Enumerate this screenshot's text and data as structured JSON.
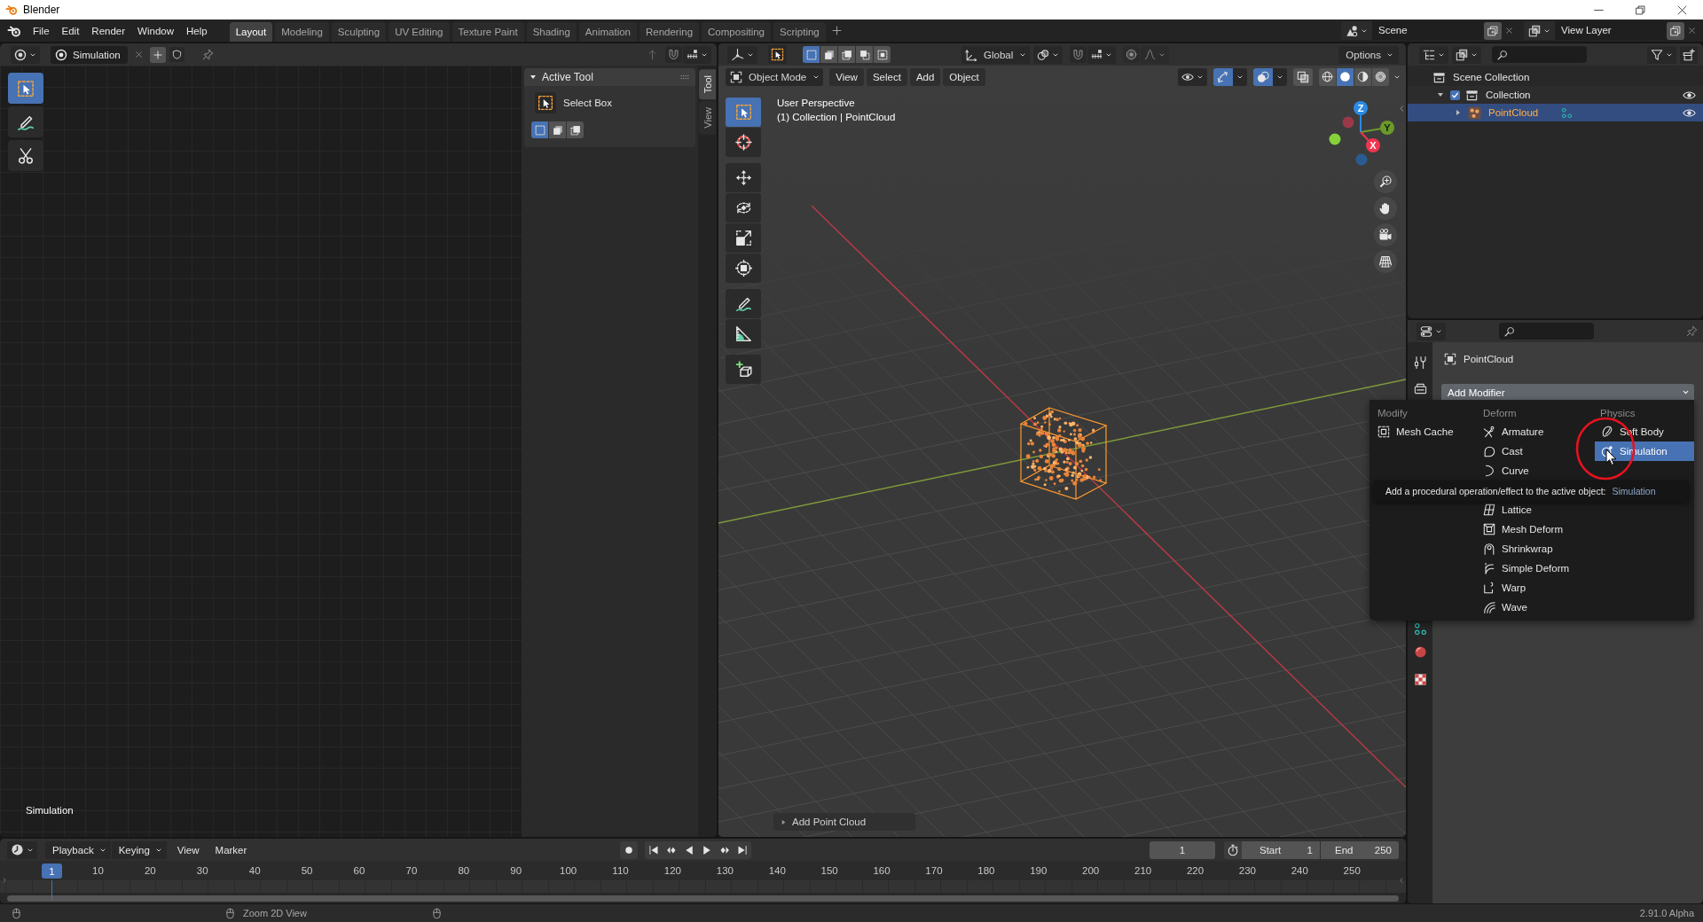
{
  "window": {
    "title": "Blender"
  },
  "menu_bar": {
    "menus": [
      "File",
      "Edit",
      "Render",
      "Window",
      "Help"
    ]
  },
  "workspaces": [
    {
      "label": "Layout",
      "selected": true
    },
    {
      "label": "Modeling",
      "selected": false
    },
    {
      "label": "Sculpting",
      "selected": false
    },
    {
      "label": "UV Editing",
      "selected": false
    },
    {
      "label": "Texture Paint",
      "selected": false
    },
    {
      "label": "Shading",
      "selected": false
    },
    {
      "label": "Animation",
      "selected": false
    },
    {
      "label": "Rendering",
      "selected": false
    },
    {
      "label": "Compositing",
      "selected": false
    },
    {
      "label": "Scripting",
      "selected": false
    }
  ],
  "scene": {
    "name": "Scene"
  },
  "view_layer": {
    "name": "View Layer"
  },
  "simulation_editor": {
    "datablock": "Simulation",
    "tools": [
      {
        "kind": "select_box",
        "selected": true
      },
      {
        "kind": "annotate",
        "selected": false
      },
      {
        "kind": "links_cut",
        "selected": false
      }
    ],
    "tree_name": "Simulation",
    "sidebar": {
      "tabs": [
        {
          "label": "Tool",
          "selected": true
        },
        {
          "label": "View",
          "selected": false
        }
      ],
      "panel": {
        "title": "Active Tool",
        "expanded": true,
        "tool": "Select Box",
        "modes": [
          {
            "selected": true
          },
          {
            "selected": false
          },
          {
            "selected": false
          }
        ]
      }
    }
  },
  "viewport": {
    "select_modes": [
      {
        "selected": true
      },
      {
        "selected": false
      },
      {
        "selected": false
      },
      {
        "selected": false
      },
      {
        "selected": false
      }
    ],
    "orientation": "Global",
    "options": "Options",
    "mode": "Object Mode",
    "menus": [
      "View",
      "Select",
      "Add",
      "Object"
    ],
    "toggles": [
      {
        "kind": "gizmos",
        "on": true
      },
      {
        "kind": "overlays",
        "on": true
      },
      {
        "kind": "xray",
        "on": false
      }
    ],
    "shading": [
      {
        "kind": "wireframe",
        "selected": false
      },
      {
        "kind": "solid",
        "selected": true
      },
      {
        "kind": "material",
        "selected": false
      },
      {
        "kind": "rendered",
        "selected": false
      }
    ],
    "tools": [
      {
        "kind": "select_box",
        "selected": true
      },
      {
        "kind": "cursor",
        "selected": false
      },
      {
        "kind": "move",
        "selected": false
      },
      {
        "kind": "rotate",
        "selected": false
      },
      {
        "kind": "scale",
        "selected": false
      },
      {
        "kind": "transform",
        "selected": false
      },
      {
        "kind": "annotate",
        "selected": false
      },
      {
        "kind": "measure",
        "selected": false
      },
      {
        "kind": "add_cube",
        "selected": false
      }
    ],
    "info": [
      "User Perspective",
      "(1) Collection | PointCloud"
    ],
    "axes": [
      "Z",
      "Y",
      "X"
    ],
    "redo_panel": {
      "label": "Add Point Cloud",
      "expanded": false
    }
  },
  "outliner": {
    "tree": [
      {
        "kind": "scene_collection",
        "label": "Scene Collection",
        "selected": false,
        "children": [
          {
            "kind": "collection",
            "label": "Collection",
            "selected": false,
            "expanded": true,
            "checked": true,
            "visible": true,
            "children": [
              {
                "kind": "object",
                "label": "PointCloud",
                "selected": true,
                "expanded": false,
                "visible": true
              }
            ]
          }
        ]
      }
    ]
  },
  "properties": {
    "object": "PointCloud",
    "add_modifier": {
      "label": "Add Modifier",
      "expanded": true
    },
    "menu": [
      {
        "heading": "Modify",
        "items": [
          {
            "kind": "mesh_cache",
            "label": "Mesh Cache",
            "selected": false
          }
        ]
      },
      {
        "heading": "Deform",
        "items": [
          {
            "kind": "armature",
            "label": "Armature",
            "selected": false
          },
          {
            "kind": "cast",
            "label": "Cast",
            "selected": false
          },
          {
            "kind": "curve",
            "label": "Curve",
            "selected": false
          },
          {
            "kind": "lattice",
            "label": "Lattice",
            "selected": false
          },
          {
            "kind": "mesh_deform",
            "label": "Mesh Deform",
            "selected": false
          },
          {
            "kind": "shrinkwrap",
            "label": "Shrinkwrap",
            "selected": false
          },
          {
            "kind": "simple_deform",
            "label": "Simple Deform",
            "selected": false
          },
          {
            "kind": "warp",
            "label": "Warp",
            "selected": false
          },
          {
            "kind": "wave",
            "label": "Wave",
            "selected": false
          }
        ]
      },
      {
        "heading": "Physics",
        "items": [
          {
            "kind": "soft_body",
            "label": "Soft Body",
            "selected": false
          },
          {
            "kind": "simulation",
            "label": "Simulation",
            "selected": true
          }
        ]
      }
    ],
    "tooltip": {
      "text": "Add a procedural operation/effect to the active object:",
      "value": "Simulation"
    }
  },
  "timeline": {
    "popovers": [
      "Playback",
      "Keying"
    ],
    "menus": [
      "View",
      "Marker"
    ],
    "current_frame": "1",
    "start": {
      "label": "Start",
      "value": "1"
    },
    "end": {
      "label": "End",
      "value": "250"
    },
    "playhead": "1",
    "ruler": [
      "10",
      "20",
      "30",
      "40",
      "50",
      "60",
      "70",
      "80",
      "90",
      "100",
      "110",
      "120",
      "130",
      "140",
      "150",
      "160",
      "170",
      "180",
      "190",
      "200",
      "210",
      "220",
      "230",
      "240",
      "250"
    ]
  },
  "status_bar": {
    "hint": "Zoom 2D View",
    "version": "2.91.0 Alpha"
  }
}
